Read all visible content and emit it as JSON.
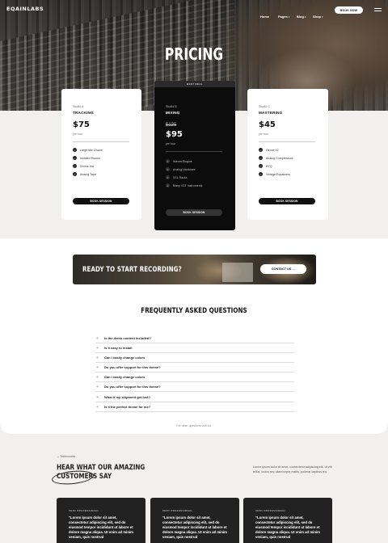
{
  "nav": {
    "logo": "EQAINLABS",
    "items": [
      "Home",
      "Pages",
      "Blog",
      "Shop"
    ],
    "book_now": "BOOK NOW"
  },
  "hero": {
    "title": "PRICING"
  },
  "plans": [
    {
      "studio": "Studio A",
      "name": "TRACKING",
      "old_price": "",
      "price": "$75",
      "per": "per hour",
      "features": [
        "Large Mic Choice",
        "Isolated Rooms",
        "Drums Incl.",
        "Analog Tape"
      ],
      "button": "BOOK SESSION"
    },
    {
      "badge": "BEST DEAL",
      "studio": "Studio B",
      "name": "MIXING",
      "old_price": "$125",
      "price": "$95",
      "per": "per hour",
      "features": [
        "Waves Plugins",
        "Analog Hardware",
        "SSL Racks",
        "Many VST Instruments"
      ],
      "button": "BOOK SESSION"
    },
    {
      "studio": "Studio C",
      "name": "MASTERING",
      "old_price": "",
      "price": "$45",
      "per": "per hour",
      "features": [
        "Ozone 12",
        "Analog Compressors",
        "EEQ",
        "Vintage Equalizers"
      ],
      "button": "BOOK SESSION"
    }
  ],
  "cta": {
    "title": "READY TO START RECORDING?",
    "button": "CONTACT US →"
  },
  "faq": {
    "title": "FREQUENTLY ASKED QUESTIONS",
    "questions": [
      "Is the demo content included?",
      "Is it easy to install",
      "Can I easily change colors",
      "Do you offer support for this theme?",
      "Can I easily change colors",
      "Do you offer support for this theme?",
      "What if my shipment get lost?",
      "Is it the perfect theme for me?"
    ],
    "footer": "For other questions visit our"
  },
  "testimonials": {
    "label": "– Testimonials",
    "heading_line1": "HEAR WHAT OUR AMAZING",
    "heading_line2": "CUSTOMERS SAY",
    "description": "Lorem ipsum dolor sit amet, consectetur adipiscing elit. Ut elit tellus, luctus nec ullamcorper mattis, pulvinar dapibus leo.",
    "cards": [
      {
        "role": "VERY PROFESSIONAL",
        "quote": "\"Lorem ipsum dolor sit amet, consectetur adipiscing elit, sed do eiusmod tempor incididunt ut labore et dolore magna aliqua. Ut enim ad minim veniam, quis nostrud"
      },
      {
        "role": "VERY PROFESSIONAL",
        "quote": "\"Lorem ipsum dolor sit amet, consectetur adipiscing elit, sed do eiusmod tempor incididunt ut labore et dolore magna aliqua. Ut enim ad minim veniam, quis nostrud"
      },
      {
        "role": "VERY PROFESSIONAL",
        "quote": "\"Lorem ipsum dolor sit amet, consectetur adipiscing elit, sed do eiusmod tempor incididunt ut labore et dolore magna aliqua. Ut enim ad minim veniam, quis nostrud"
      }
    ]
  },
  "colors": {
    "accent": "#111111",
    "page_bg": "#f1f0ee",
    "dark_card": "#0c0c0c"
  }
}
